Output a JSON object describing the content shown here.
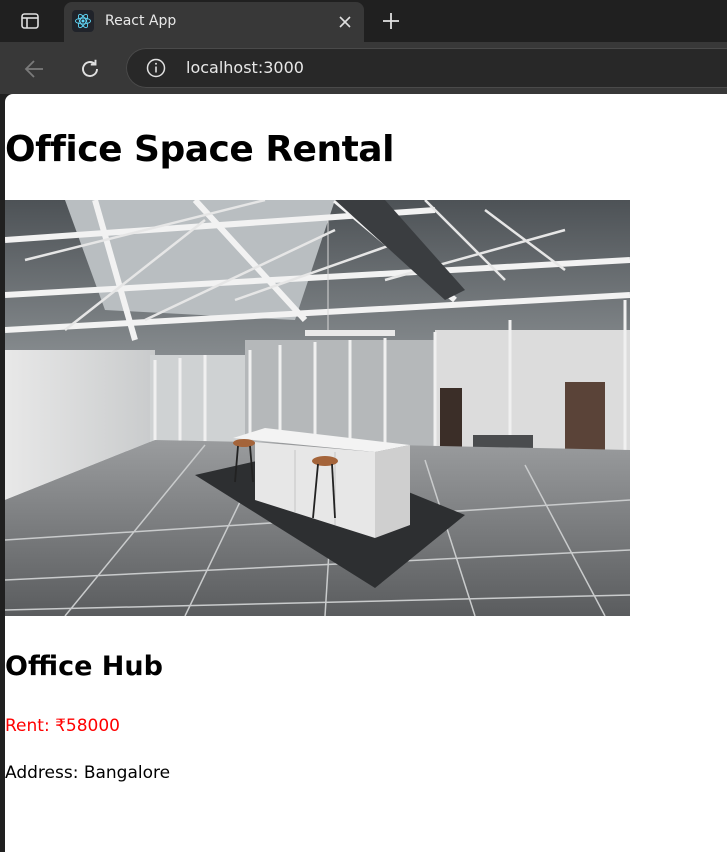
{
  "browser": {
    "tab_title": "React App",
    "url": "localhost:3000"
  },
  "icons": {
    "tab_actions": "tab-actions-icon",
    "favicon": "react-logo-icon",
    "close": "close-icon",
    "new_tab": "plus-icon",
    "back": "back-arrow-icon",
    "reload": "reload-icon",
    "site_info": "info-icon"
  },
  "page": {
    "title": "Office Space Rental",
    "listing": {
      "name": "Office Hub",
      "rent": "Rent: ₹58000",
      "address": "Address: Bangalore",
      "rent_color": "#ff0000"
    }
  }
}
